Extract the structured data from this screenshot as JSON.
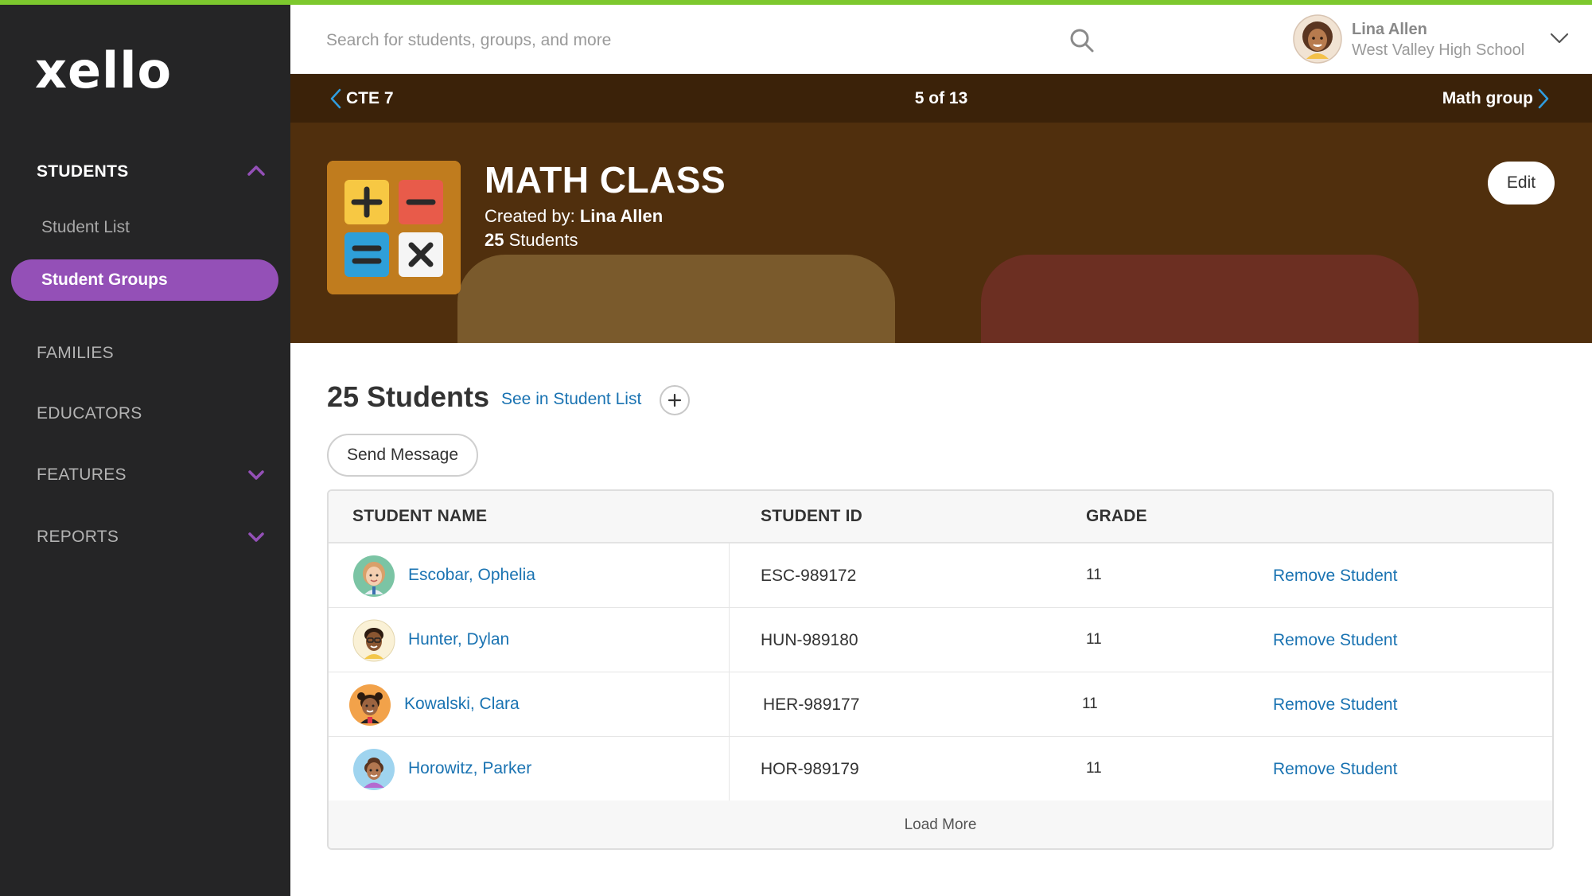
{
  "brand": {
    "name": "xello",
    "accent_color": "#7dc82e",
    "nav_active_color": "#9450b7"
  },
  "sidebar": {
    "sections": [
      {
        "label": "STUDENTS",
        "expanded": true
      },
      {
        "label": "FAMILIES"
      },
      {
        "label": "EDUCATORS"
      },
      {
        "label": "FEATURES",
        "expanded": false
      },
      {
        "label": "REPORTS",
        "expanded": false
      }
    ],
    "students_items": [
      "Student List",
      "Student Groups"
    ],
    "active_item": "Student Groups"
  },
  "header": {
    "search_placeholder": "Search for students, groups, and more",
    "user": {
      "name": "Lina Allen",
      "school": "West Valley High School"
    }
  },
  "group_nav": {
    "prev": "CTE 7",
    "counter": "5 of 13",
    "next": "Math group"
  },
  "group": {
    "title": "MATH CLASS",
    "created_by_label": "Created by:",
    "created_by": "Lina Allen",
    "count_number": "25",
    "count_label": "Students",
    "edit_label": "Edit",
    "banner_color": "#502f0d"
  },
  "students_section": {
    "heading": "25 Students",
    "see_in_list": "See in Student List",
    "send_message": "Send Message"
  },
  "table": {
    "columns": [
      "STUDENT NAME",
      "STUDENT ID",
      "GRADE"
    ],
    "rows": [
      {
        "name": "Escobar, Ophelia",
        "id": "ESC-989172",
        "grade": "11",
        "action": "Remove Student"
      },
      {
        "name": "Hunter, Dylan",
        "id": "HUN-989180",
        "grade": "11",
        "action": "Remove Student"
      },
      {
        "name": "Kowalski, Clara",
        "id": "HER-989177",
        "grade": "11",
        "action": "Remove Student"
      },
      {
        "name": "Horowitz, Parker",
        "id": "HOR-989179",
        "grade": "11",
        "action": "Remove Student"
      }
    ],
    "load_more": "Load More"
  }
}
